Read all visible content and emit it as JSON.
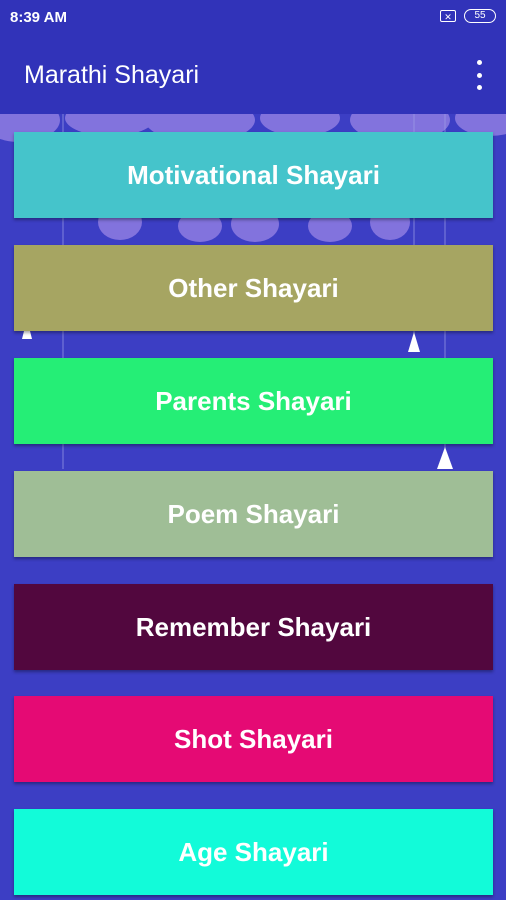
{
  "status": {
    "time": "8:39 AM",
    "battery": "55"
  },
  "app_bar": {
    "title": "Marathi Shayari",
    "menu_icon": "more-vert-icon"
  },
  "categories": [
    {
      "label": "Motivational Shayari",
      "color": "#45c4cb"
    },
    {
      "label": "Other Shayari",
      "color": "#a6a562"
    },
    {
      "label": "Parents Shayari",
      "color": "#25ee76"
    },
    {
      "label": "Poem Shayari",
      "color": "#9fbe96"
    },
    {
      "label": "Remember Shayari",
      "color": "#52073e"
    },
    {
      "label": "Shot Shayari",
      "color": "#e50a74"
    },
    {
      "label": "Age Shayari",
      "color": "#12fbd9"
    }
  ]
}
